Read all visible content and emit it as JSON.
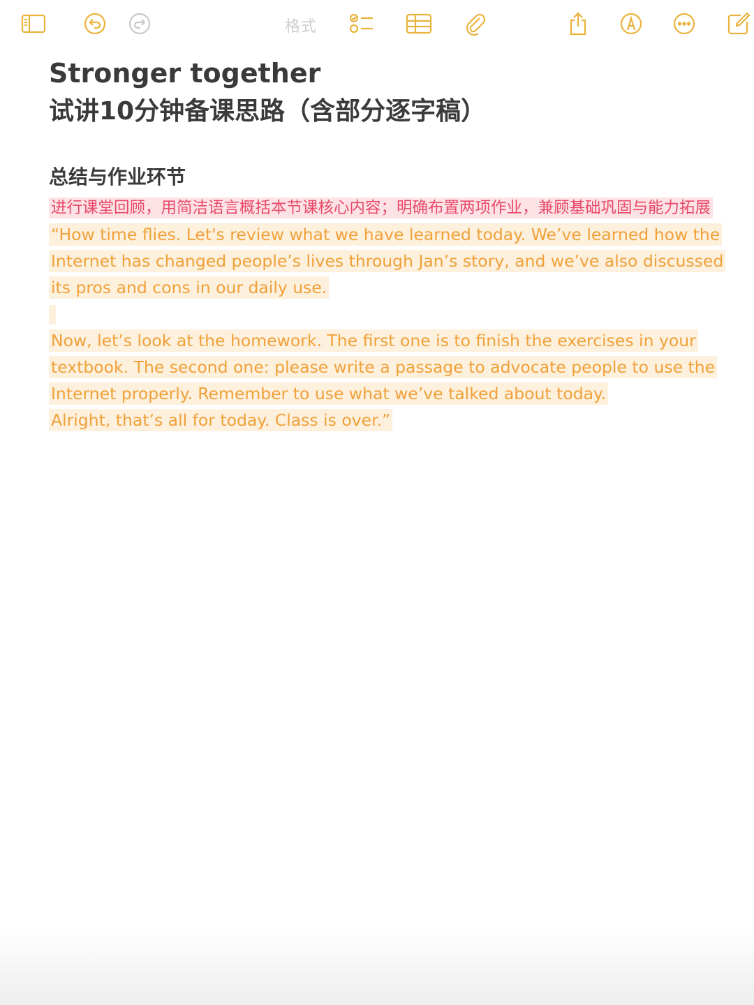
{
  "toolbar": {
    "format_label": "格式",
    "icons": [
      "sidebar-icon",
      "undo-icon",
      "redo-icon",
      "checklist-icon",
      "table-icon",
      "attachment-icon",
      "share-icon",
      "markup-icon",
      "more-icon",
      "compose-icon"
    ],
    "accent_color": "#e9b33c"
  },
  "note": {
    "title_line1": "Stronger together",
    "title_line2": "试讲10分钟备课思路（含部分逐字稿）",
    "section_heading": "总结与作业环节",
    "summary_line": "进行课堂回顾，用简洁语言概括本节课核心内容；明确布置两项作业，兼顾基础巩固与能力拓展",
    "script_para1": "“How time flies. Let's review what we have learned today. We’ve learned how the Internet has changed people’s lives through Jan’s story, and we’ve also discussed its pros and cons in our daily use.",
    "script_para2": "Now, let’s look at the homework. The first one is to finish the exercises in your textbook. The second one: please write a passage to advocate people to use the Internet properly. Remember to use what we’ve talked about today.",
    "script_para3": "Alright, that’s all for today. Class is over.”",
    "highlight_pink": "#fde3e6",
    "text_pink": "#e84a6a",
    "highlight_orange": "#fdf0dc",
    "text_orange": "#f0a13a"
  }
}
